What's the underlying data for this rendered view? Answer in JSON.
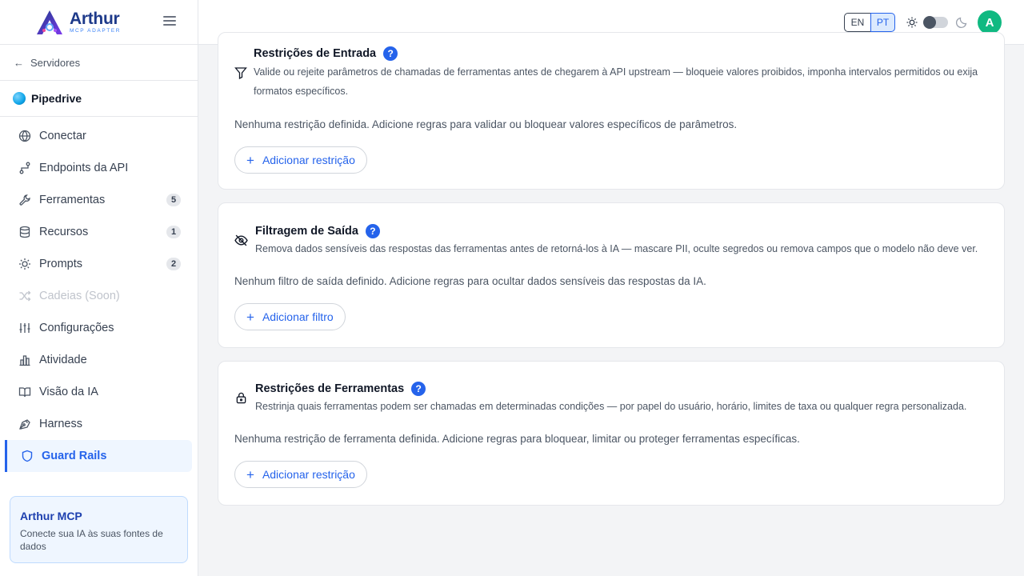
{
  "brand": {
    "name": "Arthur",
    "subtitle": "MCP ADAPTER"
  },
  "sidebar": {
    "back_label": "Servidores",
    "server_name": "Pipedrive",
    "items": [
      {
        "label": "Conectar",
        "icon": "globe-icon"
      },
      {
        "label": "Endpoints da API",
        "icon": "route-icon"
      },
      {
        "label": "Ferramentas",
        "icon": "wrench-icon",
        "badge": "5"
      },
      {
        "label": "Recursos",
        "icon": "database-icon",
        "badge": "1"
      },
      {
        "label": "Prompts",
        "icon": "lightbulb-icon",
        "badge": "2"
      },
      {
        "label": "Cadeias (Soon)",
        "icon": "shuffle-icon",
        "disabled": true
      },
      {
        "label": "Configurações",
        "icon": "sliders-icon"
      },
      {
        "label": "Atividade",
        "icon": "bar-chart-icon"
      },
      {
        "label": "Visão da IA",
        "icon": "book-open-icon"
      },
      {
        "label": "Harness",
        "icon": "pen-tool-icon"
      },
      {
        "label": "Guard Rails",
        "icon": "shield-icon",
        "active": true
      }
    ],
    "promo": {
      "title": "Arthur MCP",
      "text": "Conecte sua IA às suas fontes de dados"
    }
  },
  "header": {
    "lang_en": "EN",
    "lang_pt": "PT",
    "selected_lang": "PT",
    "theme": "light",
    "avatar_initial": "A",
    "accent": "#2563eb",
    "avatar_color": "#10b981"
  },
  "cards": {
    "input": {
      "title": "Restrições de Entrada",
      "help": "?",
      "description": "Valide ou rejeite parâmetros de chamadas de ferramentas antes de chegarem à API upstream — bloqueie valores proibidos, imponha intervalos permitidos ou exija formatos específicos.",
      "empty": "Nenhuma restrição definida. Adicione regras para validar ou bloquear valores específicos de parâmetros.",
      "button": "Adicionar restrição"
    },
    "output": {
      "title": "Filtragem de Saída",
      "help": "?",
      "description": "Remova dados sensíveis das respostas das ferramentas antes de retorná-los à IA — mascare PII, oculte segredos ou remova campos que o modelo não deve ver.",
      "empty": "Nenhum filtro de saída definido. Adicione regras para ocultar dados sensíveis das respostas da IA.",
      "button": "Adicionar filtro"
    },
    "tools": {
      "title": "Restrições de Ferramentas",
      "help": "?",
      "description": "Restrinja quais ferramentas podem ser chamadas em determinadas condições — por papel do usuário, horário, limites de taxa ou qualquer regra personalizada.",
      "empty": "Nenhuma restrição de ferramenta definida. Adicione regras para bloquear, limitar ou proteger ferramentas específicas.",
      "button": "Adicionar restrição"
    }
  }
}
